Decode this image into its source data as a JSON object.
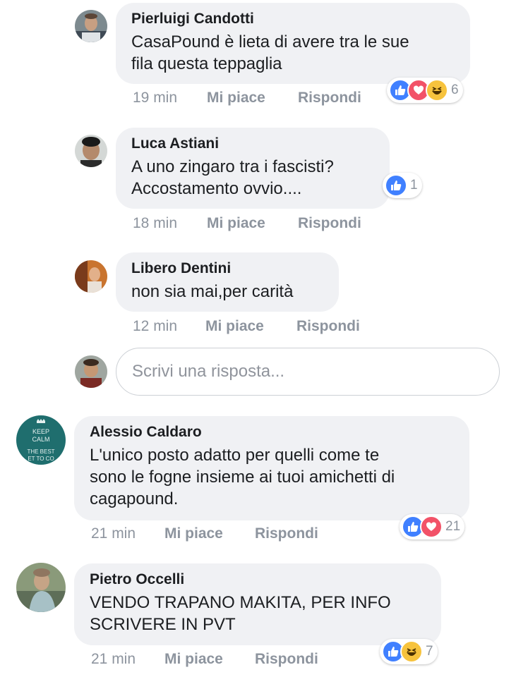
{
  "comments": [
    {
      "author": "Pierluigi Candotti",
      "text_lines": [
        "CasaPound è lieta di avere tra le sue",
        "fila questa teppaglia"
      ],
      "time": "19 min",
      "like_label": "Mi piace",
      "reply_label": "Rispondi",
      "reactions": [
        "like",
        "love",
        "haha"
      ],
      "reaction_count": "6"
    },
    {
      "author": "Luca Astiani",
      "text_lines": [
        "A uno zingaro tra i fascisti?",
        "Accostamento ovvio...."
      ],
      "time": "18 min",
      "like_label": "Mi piace",
      "reply_label": "Rispondi",
      "reactions": [
        "like"
      ],
      "reaction_count": "1"
    },
    {
      "author": "Libero Dentini",
      "text_lines": [
        "non sia mai,per carità"
      ],
      "time": "12 min",
      "like_label": "Mi piace",
      "reply_label": "Rispondi"
    },
    {
      "author": "Alessio Caldaro",
      "text_lines": [
        "L'unico posto adatto per quelli come te",
        "sono le fogne insieme ai tuoi amichetti di",
        "cagapound."
      ],
      "time": "21 min",
      "like_label": "Mi piace",
      "reply_label": "Rispondi",
      "reactions": [
        "like",
        "love"
      ],
      "reaction_count": "21",
      "avatar_text": [
        "KEEP",
        "CALM",
        "THE BEST",
        "ET TO CO"
      ]
    },
    {
      "author": "Pietro Occelli",
      "text_lines": [
        "VENDO TRAPANO MAKITA, PER INFO",
        "SCRIVERE IN PVT"
      ],
      "time": "21 min",
      "like_label": "Mi piace",
      "reply_label": "Rispondi",
      "reactions": [
        "like",
        "haha"
      ],
      "reaction_count": "7"
    }
  ],
  "reply_input": {
    "placeholder": "Scrivi una risposta..."
  },
  "colors": {
    "bubble": "#f0f1f4",
    "meta_text": "#8d949e",
    "like_blue": "#4080ff",
    "love_red": "#f25268",
    "haha_yellow": "#f7c33d"
  }
}
